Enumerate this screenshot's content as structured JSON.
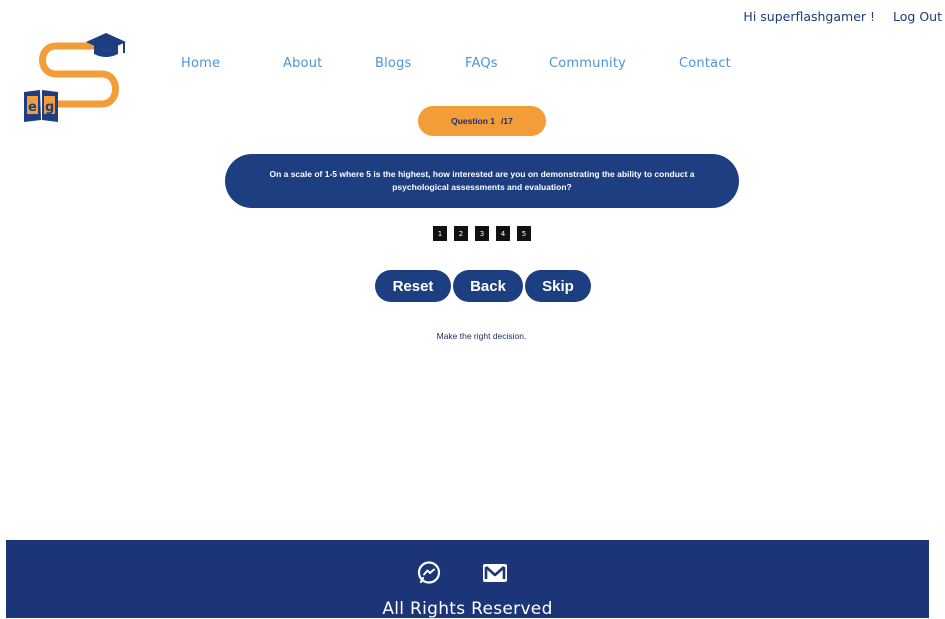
{
  "header": {
    "greeting": "Hi superflashgamer !",
    "logout_label": "Log Out"
  },
  "logo": {
    "letters": "eg"
  },
  "nav": {
    "items": [
      {
        "label": "Home"
      },
      {
        "label": "About"
      },
      {
        "label": "Blogs"
      },
      {
        "label": "FAQs"
      },
      {
        "label": "Community"
      },
      {
        "label": "Contact"
      }
    ]
  },
  "quiz": {
    "question_label": "Question 1",
    "question_total": "/17",
    "question_text": "On a scale of 1-5 where 5 is the highest, how interested are you on demonstrating the ability to conduct a psychological assessments and evaluation?",
    "ratings": [
      "1",
      "2",
      "3",
      "4",
      "5"
    ],
    "reset_label": "Reset",
    "back_label": "Back",
    "skip_label": "Skip",
    "hint": "Make the right decision."
  },
  "footer": {
    "icons": [
      "messenger-icon",
      "mail-icon"
    ],
    "rights": "All Rights Reserved"
  },
  "colors": {
    "navy": "#1d3e80",
    "footer_navy": "#1b3578",
    "orange": "#f29d38",
    "nav_blue": "#4e94d6"
  }
}
